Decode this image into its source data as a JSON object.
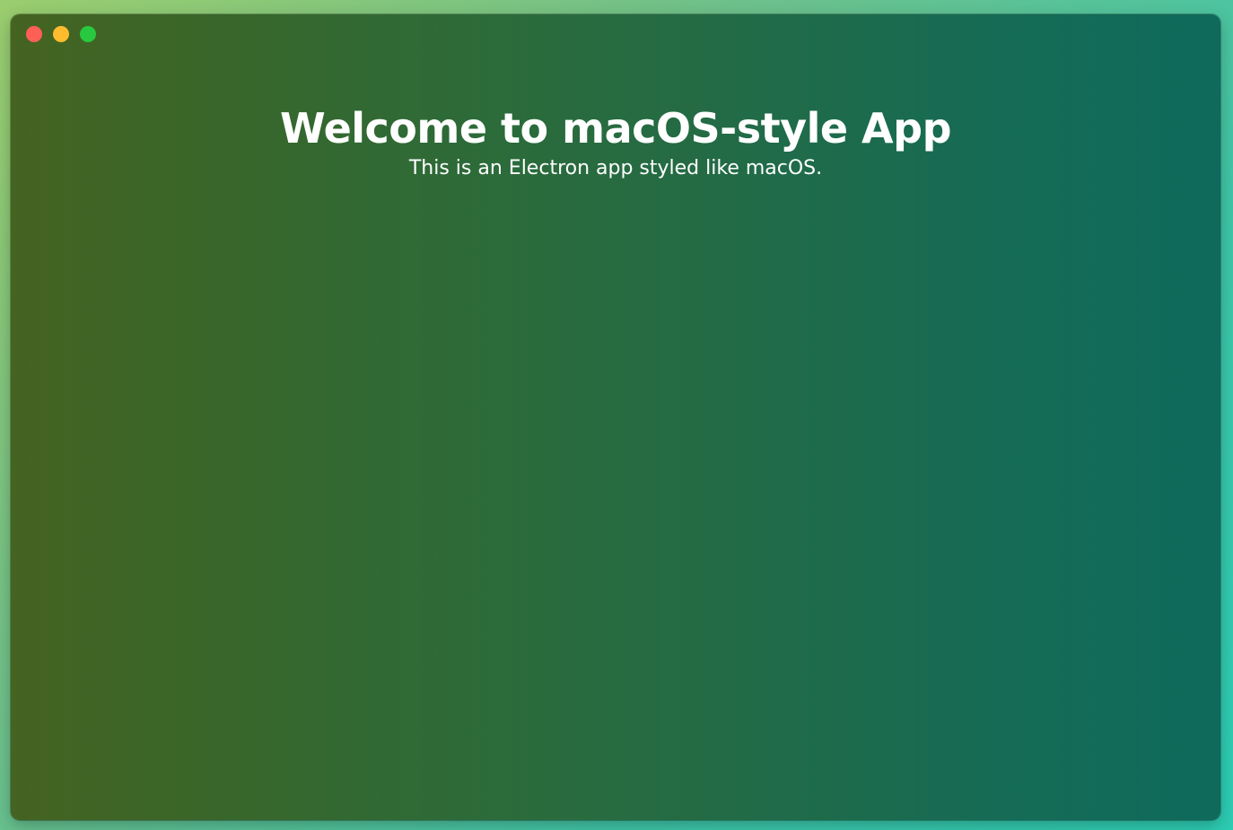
{
  "window": {
    "controls": [
      {
        "name": "close",
        "color": "#fe5f57"
      },
      {
        "name": "minimize",
        "color": "#febc2e"
      },
      {
        "name": "maximize",
        "color": "#28c840"
      }
    ]
  },
  "main": {
    "title": "Welcome to macOS-style App",
    "subtitle": "This is an Electron app styled like macOS."
  }
}
